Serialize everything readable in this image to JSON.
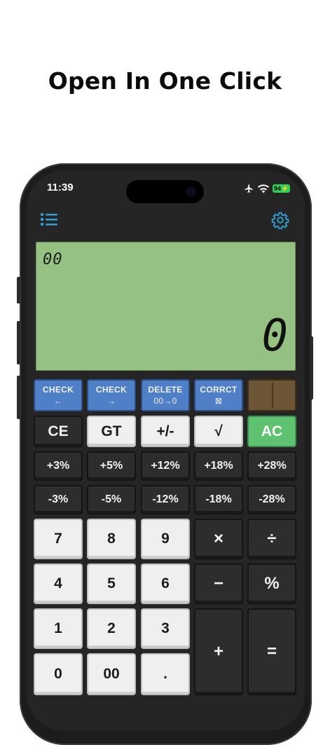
{
  "headline": "Open In One Click",
  "status": {
    "time": "11:39",
    "battery": "94"
  },
  "icons": {
    "menu": "list-menu-icon",
    "settings": "gear-icon",
    "airplane": "airplane-icon",
    "wifi": "wifi-icon"
  },
  "colors": {
    "display_bg": "#95c283",
    "blue_key": "#4f7fc6",
    "ac_key": "#5ec270",
    "accent_icon": "#2f9fd6"
  },
  "display": {
    "memory": "00",
    "value": "0"
  },
  "function_row": [
    {
      "label": "CHECK",
      "sub": "←"
    },
    {
      "label": "CHECK",
      "sub": "→"
    },
    {
      "label": "DELETE",
      "sub": "00→0"
    },
    {
      "label": "CORRCT",
      "sub": "⊠"
    }
  ],
  "row_ce": [
    "CE",
    "GT",
    "+/-",
    "√",
    "AC"
  ],
  "row_plus": [
    "+3%",
    "+5%",
    "+12%",
    "+18%",
    "+28%"
  ],
  "row_minus": [
    "-3%",
    "-5%",
    "-12%",
    "-18%",
    "-28%"
  ],
  "digits": {
    "r1": [
      "7",
      "8",
      "9"
    ],
    "r2": [
      "4",
      "5",
      "6"
    ],
    "r3": [
      "1",
      "2",
      "3"
    ],
    "r4": [
      "0",
      "00",
      "."
    ]
  },
  "ops": {
    "multiply": "×",
    "divide": "÷",
    "minus": "−",
    "percent": "%",
    "plus": "+",
    "equals": "="
  }
}
